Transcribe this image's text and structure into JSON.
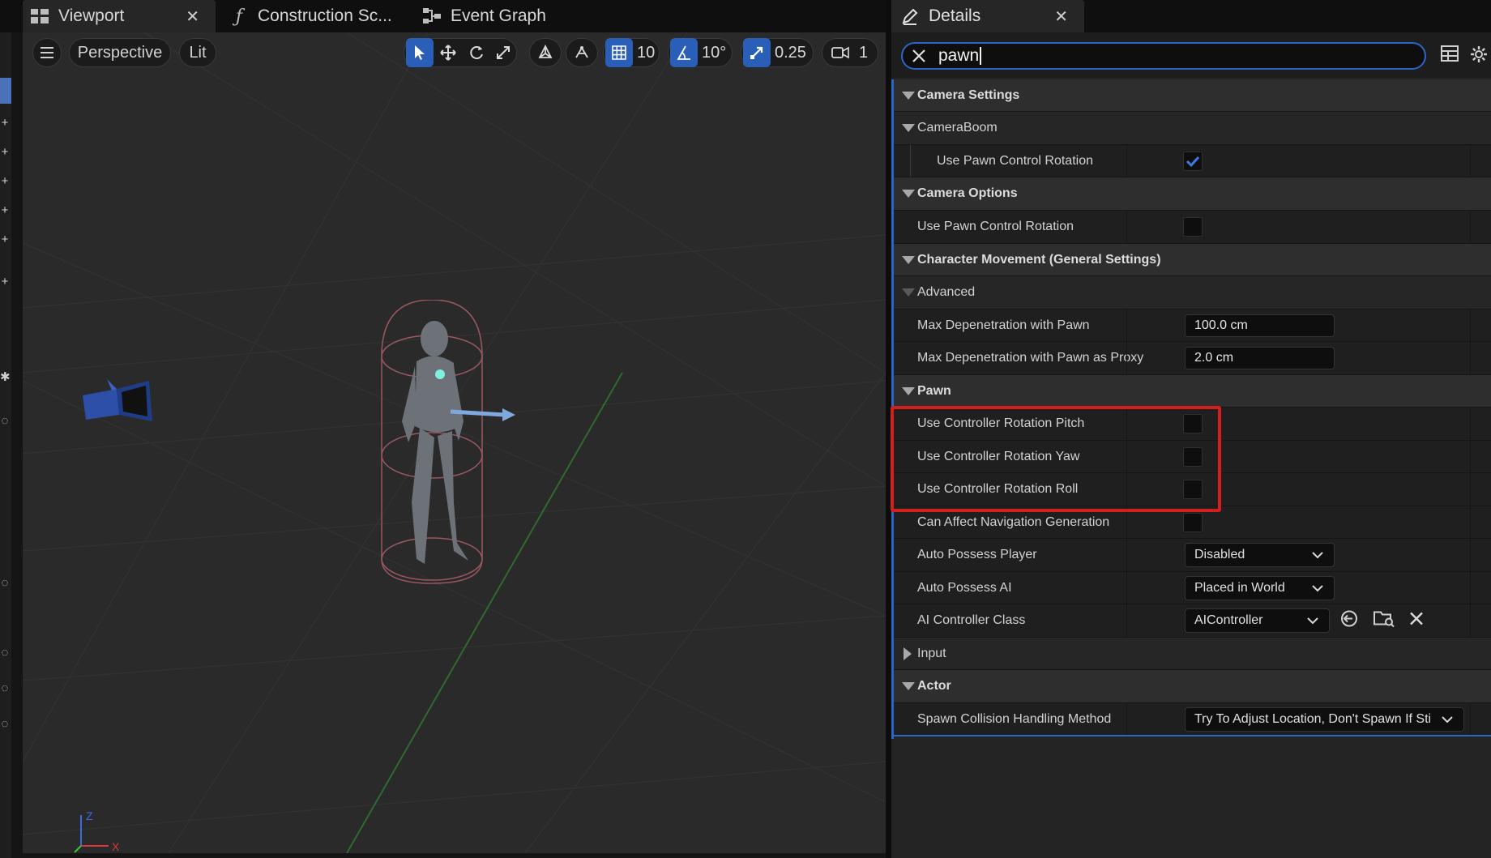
{
  "viewport_tabs": [
    {
      "label": "Viewport",
      "icon": "viewport-grid-icon"
    },
    {
      "label": "Construction Sc...",
      "icon": "function-icon"
    },
    {
      "label": "Event Graph",
      "icon": "graph-nodes-icon"
    }
  ],
  "viewport_toolbar": {
    "view_mode": "Perspective",
    "lighting": "Lit",
    "grid_snap": "10",
    "rotation_snap": "10°",
    "scale_snap": "0.25",
    "camera_speed": "1"
  },
  "axis_labels": {
    "z": "Z",
    "x": "X"
  },
  "details": {
    "tab_label": "Details",
    "search_value": "pawn",
    "categories": {
      "camera_settings": {
        "label": "Camera Settings",
        "camera_boom": {
          "label": "CameraBoom",
          "use_pawn_control_rotation": {
            "label": "Use Pawn Control Rotation",
            "checked": true
          }
        }
      },
      "camera_options": {
        "label": "Camera Options",
        "use_pawn_control_rotation": {
          "label": "Use Pawn Control Rotation",
          "checked": false
        }
      },
      "character_movement": {
        "label": "Character Movement (General Settings)",
        "advanced": {
          "label": "Advanced",
          "max_depenetration_pawn": {
            "label": "Max Depenetration with Pawn",
            "value": "100.0 cm"
          },
          "max_depenetration_proxy": {
            "label": "Max Depenetration with Pawn as Proxy",
            "value": "2.0 cm"
          }
        }
      },
      "pawn": {
        "label": "Pawn",
        "rotation_pitch": {
          "label": "Use Controller Rotation Pitch",
          "checked": false
        },
        "rotation_yaw": {
          "label": "Use Controller Rotation Yaw",
          "checked": false
        },
        "rotation_roll": {
          "label": "Use Controller Rotation Roll",
          "checked": false
        },
        "can_affect_nav": {
          "label": "Can Affect Navigation Generation",
          "checked": false
        },
        "auto_possess_player": {
          "label": "Auto Possess Player",
          "value": "Disabled"
        },
        "auto_possess_ai": {
          "label": "Auto Possess AI",
          "value": "Placed in World"
        },
        "ai_controller_class": {
          "label": "AI Controller Class",
          "value": "AIController"
        }
      },
      "input": {
        "label": "Input",
        "expanded": false
      },
      "actor": {
        "label": "Actor",
        "spawn_collision": {
          "label": "Spawn Collision Handling Method",
          "value": "Try To Adjust Location, Don't Spawn If Sti"
        }
      }
    }
  },
  "colors": {
    "accent": "#2b66c6",
    "highlight_box": "#d41f1f",
    "panel_bg": "#242424",
    "viewport_bg": "#2a2a2a"
  }
}
